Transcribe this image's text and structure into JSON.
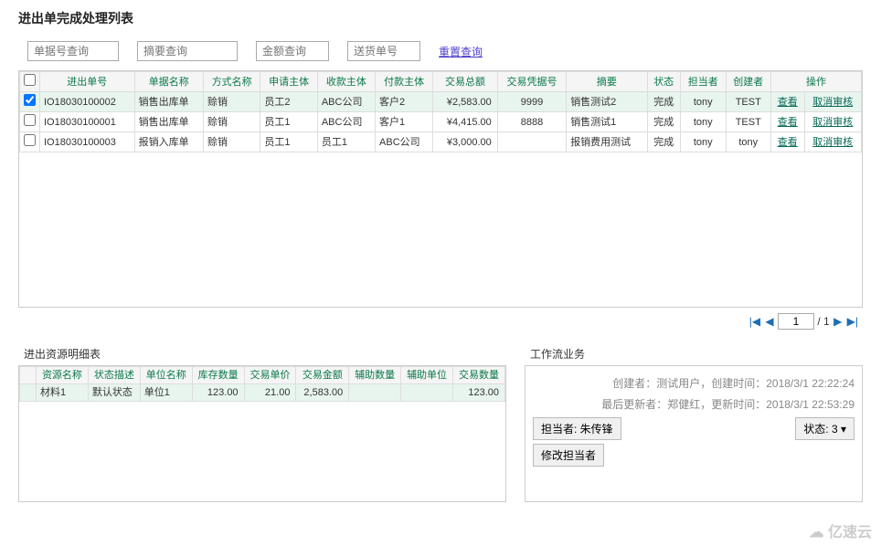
{
  "title": "进出单完成处理列表",
  "filters": {
    "docNo": "单据号查询",
    "summary": "摘要查询",
    "amount": "金额查询",
    "delivery": "送货单号",
    "reset": "重置查询"
  },
  "headers": [
    "",
    "进出单号",
    "单据名称",
    "方式名称",
    "申请主体",
    "收款主体",
    "付款主体",
    "交易总额",
    "交易凭据号",
    "摘要",
    "状态",
    "担当者",
    "创建者",
    "操作"
  ],
  "actionView": "查看",
  "actionCancel": "取消审核",
  "rows": [
    {
      "chk": true,
      "no": "IO18030100002",
      "doc": "销售出库单",
      "method": "赊销",
      "applicant": "员工2",
      "payee": "ABC公司",
      "payer": "客户2",
      "amount": "¥2,583.00",
      "voucher": "9999",
      "summary": "销售测试2",
      "status": "完成",
      "handler": "tony",
      "creator": "TEST"
    },
    {
      "chk": false,
      "no": "IO18030100001",
      "doc": "销售出库单",
      "method": "赊销",
      "applicant": "员工1",
      "payee": "ABC公司",
      "payer": "客户1",
      "amount": "¥4,415.00",
      "voucher": "8888",
      "summary": "销售测试1",
      "status": "完成",
      "handler": "tony",
      "creator": "TEST"
    },
    {
      "chk": false,
      "no": "IO18030100003",
      "doc": "报销入库单",
      "method": "赊销",
      "applicant": "员工1",
      "payee": "员工1",
      "payer": "ABC公司",
      "amount": "¥3,000.00",
      "voucher": "",
      "summary": "报销费用测试",
      "status": "完成",
      "handler": "tony",
      "creator": "tony"
    }
  ],
  "pager": {
    "page": "1",
    "total": "1",
    "sep": "/"
  },
  "detailTitle": "进出资源明细表",
  "detailHeaders": [
    "",
    "资源名称",
    "状态描述",
    "单位名称",
    "库存数量",
    "交易单价",
    "交易金额",
    "辅助数量",
    "辅助单位",
    "交易数量"
  ],
  "detailRows": [
    {
      "name": "材料1",
      "status": "默认状态",
      "unit": "单位1",
      "stock": "123.00",
      "price": "21.00",
      "amount": "2,583.00",
      "aux": "",
      "auxUnit": "",
      "qty": "123.00"
    }
  ],
  "workflow": {
    "title": "工作流业务",
    "creator": "创建者：测试用户，创建时间：2018/3/1 22:22:24",
    "updater": "最后更新者：郑健红，更新时间：2018/3/1 22:53:29",
    "handler": "担当者: 朱传锋",
    "statusBtn": "状态: 3",
    "modify": "修改担当者"
  },
  "watermark": "亿速云"
}
